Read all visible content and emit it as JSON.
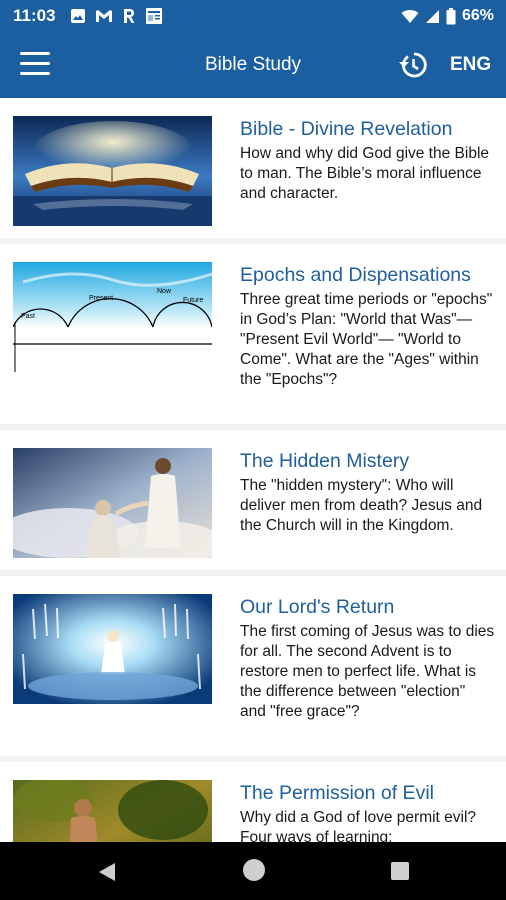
{
  "status": {
    "time": "11:03",
    "battery": "66%"
  },
  "appbar": {
    "title": "Bible Study",
    "language": "ENG"
  },
  "lessons": [
    {
      "title": "Bible - Divine Revelation",
      "description": "How and why did God give the Bible to man. The Bible’s moral influence and character."
    },
    {
      "title": "Epochs and Dispensations",
      "description": "Three great time periods or \"epochs\" in God’s Plan: \"World that Was\"— \"Present Evil World\"— \"World to Come\". What are the \"Ages\" within the \"Epochs\"?",
      "image_labels": {
        "past": "Past",
        "present": "Present",
        "now": "Now",
        "future": "Future"
      }
    },
    {
      "title": "The Hidden Mistery",
      "description": "The \"hidden mystery\": Who will deliver men from death? Jesus and the Church will in the Kingdom."
    },
    {
      "title": "Our Lord's Return",
      "description": "The first coming of Jesus was to dies for all. The second Advent is to restore men to perfect life. What is the difference between \"election\" and \"free grace\"?"
    },
    {
      "title": "The Permission of Evil",
      "description": "Why did a God of love permit evil?  Four ways of learning:"
    }
  ],
  "colors": {
    "primary": "#1b5fa0",
    "title_text": "#1f5f9e"
  },
  "icons": {
    "menu": "hamburger-icon",
    "history": "history-icon",
    "back": "back-triangle-icon",
    "home": "home-circle-icon",
    "recent": "recent-square-icon"
  }
}
